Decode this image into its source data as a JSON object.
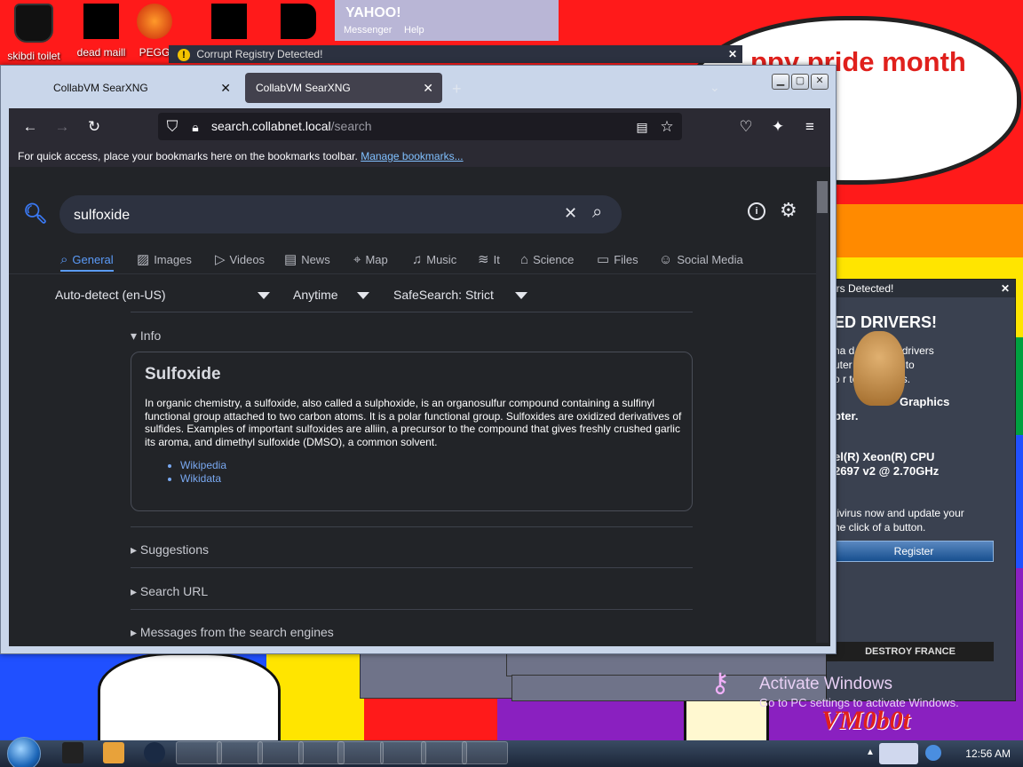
{
  "desktop": {
    "icons": [
      {
        "label": "skibdi toilet",
        "icon": "trash-bin-icon"
      },
      {
        "label": "dead maill",
        "icon": "mail-folder-icon"
      },
      {
        "label": "PEGG",
        "icon": "firefox-icon"
      },
      {
        "label": "",
        "icon": "explosion-icon"
      },
      {
        "label": "",
        "icon": "internet-explorer-icon"
      }
    ],
    "bubble_text": "ppy pride month",
    "yahoo": {
      "logo": "YAHOO!",
      "messenger": "Messenger",
      "help": "Help"
    },
    "colors": {
      "red": "#ff1a1a",
      "orange": "#ff8a00",
      "yellow": "#ffe500",
      "green": "#00a040",
      "blue": "#2050ff",
      "purple": "#8a20c0"
    }
  },
  "xp_dialog": {
    "title": "Corrupt Registry Detected!"
  },
  "popup": {
    "title": "ers Detected!",
    "heading": "ED DRIVERS!",
    "lines": [
      "ha    d outdated drivers",
      "uter    mmended to",
      "o r        tem crashes."
    ],
    "graphics": "Graphics",
    "pter": "pter.",
    "cpu1": "el(R) Xeon(R) CPU",
    "cpu2": "2697 v2 @ 2.70GHz",
    "act1": "tivirus now and update your",
    "act2": "he click of a button.",
    "register": "Register",
    "destroy": "DESTROY FRANCE"
  },
  "browser": {
    "tabs": [
      {
        "label": "CollabVM SearXNG",
        "active": false
      },
      {
        "label": "CollabVM SearXNG",
        "active": true
      }
    ],
    "url_host": "search.collabnet.local",
    "url_path": "/search",
    "bookmarks_msg": "For quick access, place your bookmarks here on the bookmarks toolbar.",
    "bookmarks_link": "Manage bookmarks..."
  },
  "searx": {
    "query": "sulfoxide",
    "categories": [
      {
        "label": "General",
        "icon": "search-icon",
        "active": true
      },
      {
        "label": "Images",
        "icon": "image-icon",
        "active": false
      },
      {
        "label": "Videos",
        "icon": "play-icon",
        "active": false
      },
      {
        "label": "News",
        "icon": "newspaper-icon",
        "active": false
      },
      {
        "label": "Map",
        "icon": "map-pin-icon",
        "active": false
      },
      {
        "label": "Music",
        "icon": "music-note-icon",
        "active": false
      },
      {
        "label": "It",
        "icon": "layers-icon",
        "active": false
      },
      {
        "label": "Science",
        "icon": "science-icon",
        "active": false
      },
      {
        "label": "Files",
        "icon": "files-icon",
        "active": false
      },
      {
        "label": "Social Media",
        "icon": "people-icon",
        "active": false
      }
    ],
    "filters": {
      "language": "Auto-detect (en-US)",
      "time": "Anytime",
      "safesearch": "SafeSearch: Strict"
    },
    "info_label": "Info",
    "infobox": {
      "title": "Sulfoxide",
      "text": "In organic chemistry, a sulfoxide, also called a sulphoxide, is an organosulfur compound containing a sulfinyl functional group attached to two carbon atoms. It is a polar functional group. Sulfoxides are oxidized derivatives of sulfides. Examples of important sulfoxides are alliin, a precursor to the compound that gives freshly crushed garlic its aroma, and dimethyl sulfoxide (DMSO), a common solvent.",
      "links": [
        "Wikipedia",
        "Wikidata"
      ]
    },
    "sections": [
      "Suggestions",
      "Search URL",
      "Messages from the search engines"
    ]
  },
  "watermark": {
    "title": "Activate Windows",
    "subtitle": "Go to PC settings to activate Windows."
  },
  "taskbar": {
    "clock": "12:56 AM"
  }
}
